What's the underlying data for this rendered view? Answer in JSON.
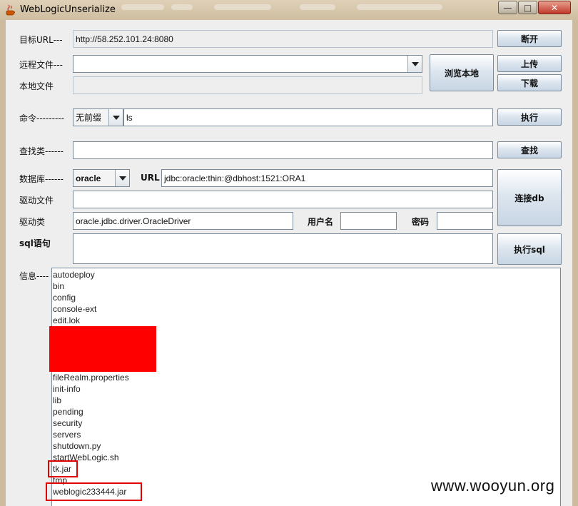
{
  "window": {
    "title": "WebLogicUnserialize"
  },
  "target": {
    "label": "目标URL---",
    "value": "http://58.252.101.24:8080",
    "disconnect_button": "断开"
  },
  "remote_file": {
    "label": "远程文件---",
    "value": "",
    "browse_button": "浏览本地",
    "upload_button": "上传",
    "download_button": "下载"
  },
  "local_file": {
    "label": "本地文件",
    "value": ""
  },
  "command": {
    "label": "命令---------",
    "prefix_selected": "无前缀",
    "value": "ls",
    "execute_button": "执行"
  },
  "find_class": {
    "label": "查找类------",
    "value": "",
    "find_button": "查找"
  },
  "database": {
    "label": "数据库------",
    "db_selected": "oracle",
    "url_label": "URL",
    "url_value": "jdbc:oracle:thin:@dbhost:1521:ORA1",
    "connect_button": "连接db"
  },
  "driver_file": {
    "label": "驱动文件",
    "value": ""
  },
  "driver_class": {
    "label": "驱动类",
    "value": "oracle.jdbc.driver.OracleDriver",
    "username_label": "用户名",
    "username_value": "",
    "password_label": "密码",
    "password_value": ""
  },
  "sql": {
    "label": "sql语句",
    "value": "",
    "execute_button": "执行sql"
  },
  "info": {
    "label": "信息----",
    "lines": [
      "autodeploy",
      "bin",
      "config",
      "console-ext",
      "edit.lok",
      "",
      "",
      "",
      "",
      "fileRealm.properties",
      "init-info",
      "lib",
      "pending",
      "security",
      "servers",
      "shutdown.py",
      "startWebLogic.sh",
      "tk.jar",
      "tmp",
      "weblogic233444.jar"
    ]
  },
  "watermark": "www.wooyun.org",
  "colors": {
    "redaction": "#ff0000",
    "highlight_box": "#e00000"
  }
}
